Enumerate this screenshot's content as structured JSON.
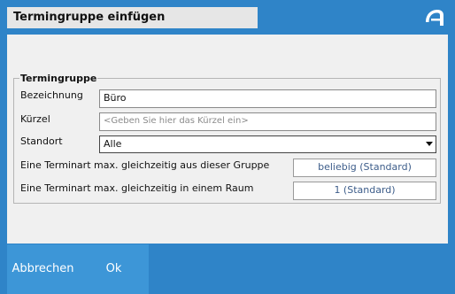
{
  "dialog": {
    "title": "Termingruppe einfügen"
  },
  "form": {
    "group_legend": "Termingruppe",
    "bezeichnung": {
      "label": "Bezeichnung",
      "value": "Büro"
    },
    "kuerzel": {
      "label": "Kürzel",
      "placeholder": "<Geben Sie hier das Kürzel ein>"
    },
    "standort": {
      "label": "Standort",
      "value": "Alle"
    },
    "max_gruppe": {
      "label": "Eine Terminart max. gleichzeitig aus dieser Gruppe",
      "value": "beliebig (Standard)"
    },
    "max_raum": {
      "label": "Eine Terminart max. gleichzeitig in einem Raum",
      "value": "1 (Standard)"
    }
  },
  "footer": {
    "cancel_label": "Abbrechen",
    "ok_label": "Ok"
  },
  "colors": {
    "background_blue": "#2f84c8",
    "button_blue": "#3d96d7",
    "panel_grey": "#f0f0f0"
  }
}
